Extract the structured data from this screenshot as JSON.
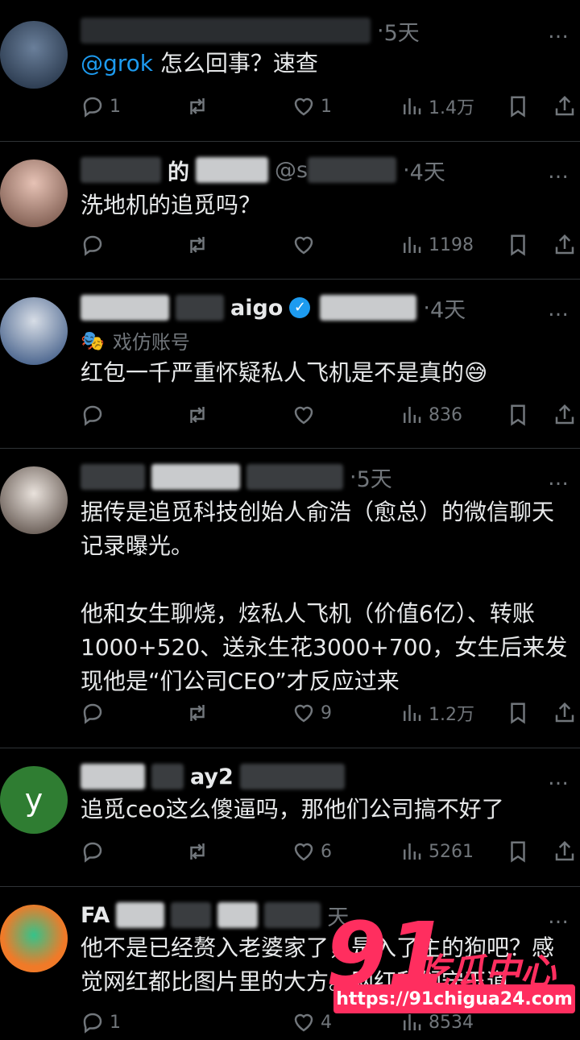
{
  "posts": [
    {
      "time": "5天",
      "mention": "@grok",
      "text": " 怎么回事？速查",
      "stats": {
        "reply": "1",
        "like": "1",
        "views": "1.4万"
      }
    },
    {
      "name_part": "的",
      "handle": "@s",
      "time": "4天",
      "text": "洗地机的追觅吗？",
      "stats": {
        "reply": "",
        "like": "",
        "views": "1198"
      }
    },
    {
      "name_part": "aigo",
      "time": "4天",
      "sub_label": "戏仿账号",
      "text": "红包一千严重怀疑私人飞机是不是真的😅",
      "stats": {
        "reply": "",
        "like": "",
        "views": "836"
      }
    },
    {
      "time": "5天",
      "text": "据传是追觅科技创始人俞浩（愈总）的微信聊天记录曝光。\n\n他和女生聊烧，炫私人飞机（价值6亿）、转账1000+520、送永生花3000+700，女生后来发现他是“们公司CEO”才反应过来",
      "stats": {
        "reply": "",
        "like": "9",
        "views": "1.2万"
      }
    },
    {
      "avatar_letter": "y",
      "name_part": "ay2",
      "text": "追觅ceo这么傻逼吗，那他们公司搞不好了",
      "stats": {
        "reply": "",
        "like": "6",
        "views": "5261"
      }
    },
    {
      "name_part": "FA",
      "time": "天",
      "text": "他不是已经赘入老婆家了，是入了主的狗吧？感觉网红都比图片里的大方。网红我们守玉道",
      "stats": {
        "reply": "1",
        "like": "4",
        "views": "8534"
      }
    }
  ],
  "more_icon": "…",
  "watermark": {
    "brand_number": "91",
    "brand_text": "吃瓜中心",
    "url": "https://91chigua24.com"
  }
}
